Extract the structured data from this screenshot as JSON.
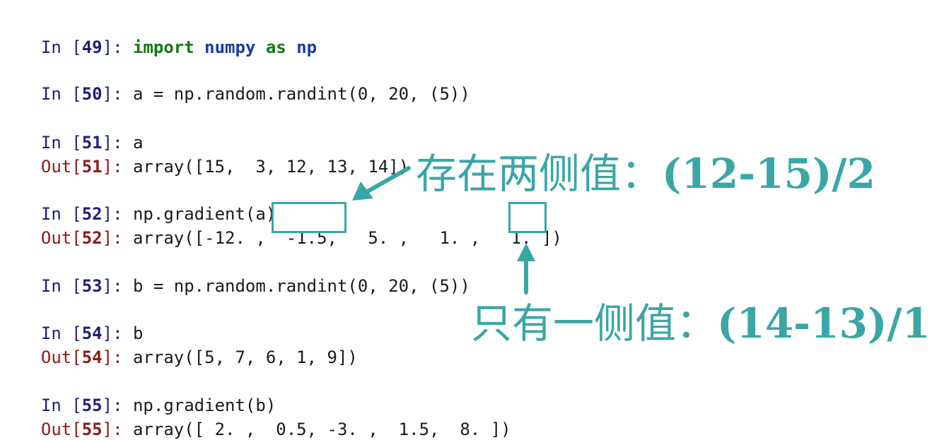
{
  "cells": [
    {
      "id": "49",
      "in_label": "In",
      "in_code": "",
      "py_kw": "import",
      "py_mod1": "numpy",
      "py_kw2": "as",
      "py_mod2": "np"
    },
    {
      "id": "50",
      "in_label": "In",
      "in_code": "a = np.random.randint(0, 20, (5))"
    },
    {
      "id": "51",
      "in_label": "In",
      "in_code": "a",
      "out_label": "Out",
      "out_code": "array([15,  3, 12, 13, 14])"
    },
    {
      "id": "52",
      "in_label": "In",
      "in_code": "np.gradient(a)",
      "out_label": "Out",
      "out_code": "array([-12. ,  -1.5,   5. ,   1. ,   1. ])"
    },
    {
      "id": "53",
      "in_label": "In",
      "in_code": "b = np.random.randint(0, 20, (5))"
    },
    {
      "id": "54",
      "in_label": "In",
      "in_code": "b",
      "out_label": "Out",
      "out_code": "array([5, 7, 6, 1, 9])"
    },
    {
      "id": "55",
      "in_label": "In",
      "in_code": "np.gradient(b)",
      "out_label": "Out",
      "out_code": "array([ 2. ,  0.5, -3. ,  1.5,  8. ])"
    }
  ],
  "annotations": {
    "both_sides_cn": "存在两侧值：",
    "both_sides_formula": "(12-15)/2",
    "one_side_cn": "只有一侧值：",
    "one_side_formula": "(14-13)/1"
  },
  "colors": {
    "accent": "#3aa6a6",
    "in_prompt": "#1f1f78",
    "out_prompt": "#8b1a1a",
    "keyword": "#137a13",
    "module": "#1a3aa0"
  }
}
